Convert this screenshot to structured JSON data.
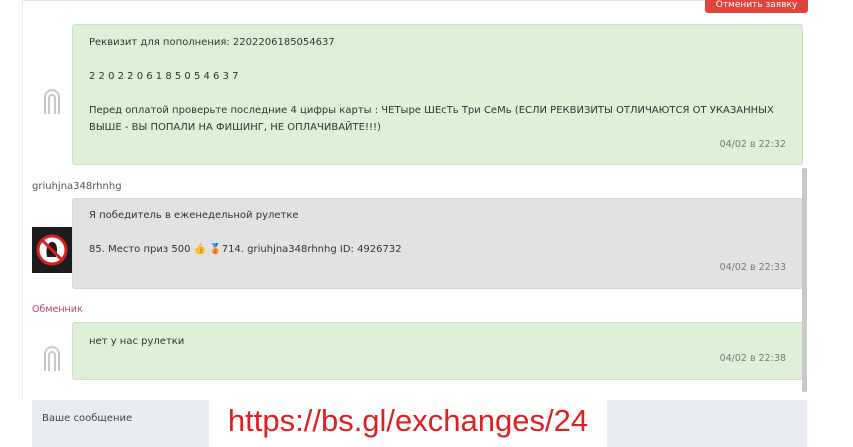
{
  "header": {
    "cancel_button": "Отменить заявку"
  },
  "messages": [
    {
      "author": "",
      "lines": [
        "Реквизит для пополнения: 2202206185054637",
        "2 2 0 2 2 0 6 1 8 5 0 5 4 6 3 7",
        "Перед оплатой проверьте последние 4 цифры карты : ЧЕТыре ШЕсТь Три СеМь (ЕСЛИ РЕКВИЗИТЫ ОТЛИЧАЮТСЯ ОТ УКАЗАННЫХ",
        "ВЫШЕ - ВЫ ПОПАЛИ НА ФИШИНГ, НЕ ОПЛАЧИВАЙТЕ!!!)"
      ],
      "time": "04/02 в 22:32"
    },
    {
      "author": "griuhjna348rhnhg",
      "lines": [
        "Я победитель в еженедельной рулетке",
        "85. Место приз 500 👍 🥉714. griuhjna348rhnhg ID: 4926732"
      ],
      "time": "04/02 в 22:33"
    },
    {
      "author": "Обменник",
      "lines": [
        "нет у нас рулетки"
      ],
      "time": "04/02 в 22:38"
    }
  ],
  "composer": {
    "placeholder": "Ваше сообщение"
  },
  "watermark": "https://bs.gl/exchanges/24",
  "colors": {
    "exchanger_bubble": "#dff0d8",
    "user_bubble": "#e2e2e2",
    "cancel_button": "#e0443c",
    "watermark": "#e02020"
  }
}
